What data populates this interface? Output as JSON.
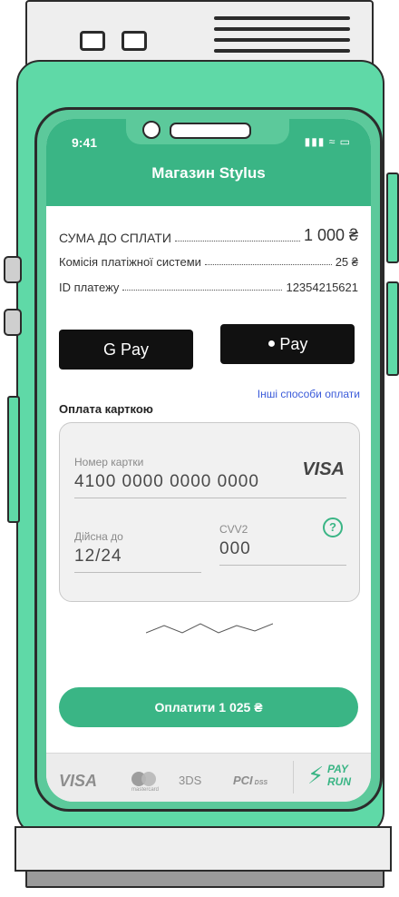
{
  "status_bar": {
    "time": "9:41",
    "icons": "▮▮▮ ≈ ▭"
  },
  "header": {
    "title": "Магазин Stylus"
  },
  "summary": {
    "amount_label": "СУМА ДО СПЛАТИ",
    "amount_value": "1 000 ₴",
    "fee_label": "Комісія платіжної системи",
    "fee_value": "25 ₴",
    "id_label": "ID платежу",
    "id_value": "12354215621"
  },
  "wallets": {
    "google_pay": "G Pay",
    "apple_pay": "Pay"
  },
  "card_section": {
    "title": "Оплата карткою",
    "other_methods": "Інші способи оплати"
  },
  "card": {
    "number_label": "Номер картки",
    "number_value": "4100 0000 0000 0000",
    "brand": "VISA",
    "expiry_label": "Дійсна до",
    "expiry_value": "12/24",
    "cvv_label": "CVV2",
    "cvv_value": "000",
    "help_icon": "question-circle-icon"
  },
  "cta": {
    "label": "Оплатити 1 025 ₴"
  },
  "footer": {
    "visa": "VISA",
    "mastercard": "mastercard",
    "threeds": "3DS",
    "pci": "PCI",
    "dss": "DSS",
    "payrun_line1": "PAY",
    "payrun_line2": "RUN"
  },
  "colors": {
    "accent": "#3ab585",
    "device": "#5fd9a7",
    "link": "#3b5bd9"
  }
}
